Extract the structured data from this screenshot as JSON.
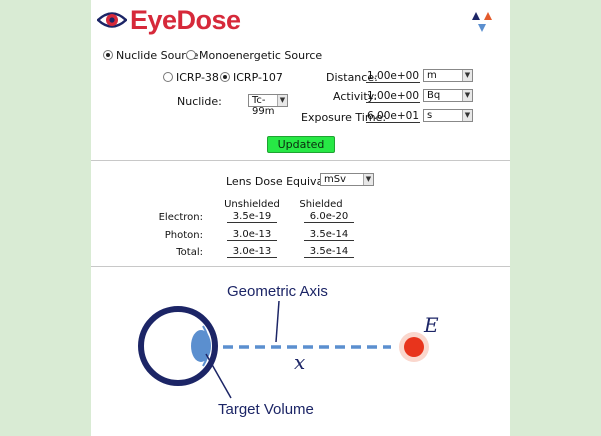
{
  "app": {
    "title": "EyeDose"
  },
  "source": {
    "options": [
      "Nuclide Source",
      "Monoenergetic Source"
    ],
    "selected": "Nuclide Source"
  },
  "icrp": {
    "options": [
      "ICRP-38",
      "ICRP-107"
    ],
    "selected": "ICRP-107"
  },
  "nuclide": {
    "label": "Nuclide:",
    "value": "Tc-99m"
  },
  "distance": {
    "label": "Distance:",
    "value": "1.00e+00",
    "unit": "m"
  },
  "activity": {
    "label": "Activity:",
    "value": "1.00e+00",
    "unit": "Bq"
  },
  "exposure": {
    "label": "Exposure Time:",
    "value": "6.00e+01",
    "unit": "s"
  },
  "update_button": {
    "label": "Updated",
    "color": "#27e845"
  },
  "lens_dose": {
    "label": "Lens Dose Equivalent:",
    "unit": "mSv"
  },
  "results": {
    "columns": [
      "Unshielded",
      "Shielded"
    ],
    "rows": [
      {
        "label": "Electron:",
        "unshielded": "3.5e-19",
        "shielded": "6.0e-20"
      },
      {
        "label": "Photon:",
        "unshielded": "3.0e-13",
        "shielded": "3.5e-14"
      },
      {
        "label": "Total:",
        "unshielded": "3.0e-13",
        "shielded": "3.5e-14"
      }
    ]
  },
  "diagram": {
    "axis_label": "Geometric Axis",
    "target_label": "Target Volume",
    "distance_symbol": "x",
    "energy_symbol": "E",
    "colors": {
      "eye": "#1c2566",
      "lens": "#5b8fcf",
      "axis": "#5b8fcf",
      "source": "#e8341c"
    }
  },
  "colors": {
    "accent": "#d6293a",
    "background": "#d9ebd4"
  }
}
